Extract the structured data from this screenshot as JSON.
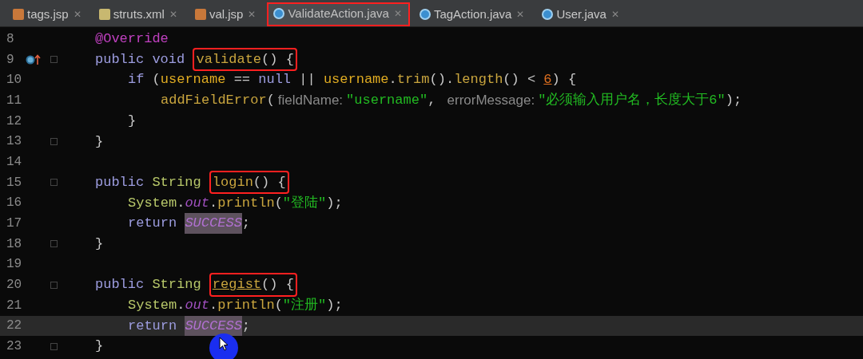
{
  "tabs": [
    {
      "label": "tags.jsp",
      "kind": "jsp",
      "close": "✕",
      "selected": false,
      "boxed": false
    },
    {
      "label": "struts.xml",
      "kind": "xml",
      "close": "✕",
      "selected": false,
      "boxed": false
    },
    {
      "label": "val.jsp",
      "kind": "jsp",
      "close": "✕",
      "selected": false,
      "boxed": false
    },
    {
      "label": "ValidateAction.java",
      "kind": "class",
      "close": "✕",
      "selected": true,
      "boxed": true
    },
    {
      "label": "TagAction.java",
      "kind": "class",
      "close": "✕",
      "selected": false,
      "boxed": false
    },
    {
      "label": "User.java",
      "kind": "class",
      "close": "✕",
      "selected": false,
      "boxed": false
    }
  ],
  "lines": [
    {
      "number": "8",
      "kind": "member",
      "current": false,
      "fold": false,
      "override": false,
      "tokens": [
        {
          "kind": "annotation",
          "text": "@Override"
        }
      ]
    },
    {
      "number": "9",
      "kind": "member",
      "current": false,
      "fold": true,
      "override": true,
      "tokens": [
        {
          "kind": "keyword",
          "text": "public "
        },
        {
          "kind": "keyword",
          "text": "void "
        },
        {
          "kind": "group",
          "boxed": true,
          "tokens": [
            {
              "kind": "method",
              "text": "validate"
            },
            {
              "kind": "plain",
              "text": "() {"
            }
          ]
        }
      ]
    },
    {
      "number": "10",
      "kind": "statement",
      "current": false,
      "fold": false,
      "override": false,
      "tokens": [
        {
          "kind": "keyword",
          "text": "if"
        },
        {
          "kind": "plain",
          "text": " ("
        },
        {
          "kind": "field",
          "text": "username"
        },
        {
          "kind": "plain",
          "text": " == "
        },
        {
          "kind": "keyword",
          "text": "null"
        },
        {
          "kind": "plain",
          "text": " || "
        },
        {
          "kind": "field",
          "text": "username"
        },
        {
          "kind": "plain",
          "text": "."
        },
        {
          "kind": "method",
          "text": "trim"
        },
        {
          "kind": "plain",
          "text": "()."
        },
        {
          "kind": "method",
          "text": "length"
        },
        {
          "kind": "plain",
          "text": "() < "
        },
        {
          "kind": "number",
          "text": "6"
        },
        {
          "kind": "plain",
          "text": ") {"
        }
      ]
    },
    {
      "number": "11",
      "kind": "nested",
      "current": false,
      "fold": false,
      "override": false,
      "tokens": [
        {
          "kind": "method",
          "text": "addFieldError"
        },
        {
          "kind": "plain",
          "text": "("
        },
        {
          "kind": "hint",
          "text": "fieldName:"
        },
        {
          "kind": "string",
          "text": "\"username\""
        },
        {
          "kind": "plain",
          "text": ", "
        },
        {
          "kind": "hint",
          "text": "errorMessage:"
        },
        {
          "kind": "string",
          "text": "\"必须输入用户名，长度大于6\""
        },
        {
          "kind": "plain",
          "text": ");"
        }
      ]
    },
    {
      "number": "12",
      "kind": "statement",
      "current": false,
      "fold": false,
      "override": false,
      "tokens": [
        {
          "kind": "plain",
          "text": "}"
        }
      ]
    },
    {
      "number": "13",
      "kind": "member",
      "current": false,
      "fold": true,
      "override": false,
      "tokens": [
        {
          "kind": "plain",
          "text": "}"
        }
      ]
    },
    {
      "number": "14",
      "kind": "blank",
      "current": false,
      "fold": false,
      "override": false
    },
    {
      "number": "15",
      "kind": "member",
      "current": false,
      "fold": true,
      "override": false,
      "tokens": [
        {
          "kind": "keyword",
          "text": "public "
        },
        {
          "kind": "type",
          "text": "String "
        },
        {
          "kind": "group",
          "boxed": true,
          "tokens": [
            {
              "kind": "method",
              "text": "login"
            },
            {
              "kind": "plain",
              "text": "() {"
            }
          ]
        }
      ]
    },
    {
      "number": "16",
      "kind": "statement",
      "current": false,
      "fold": false,
      "override": false,
      "tokens": [
        {
          "kind": "type",
          "text": "System"
        },
        {
          "kind": "plain",
          "text": "."
        },
        {
          "kind": "static",
          "text": "out"
        },
        {
          "kind": "plain",
          "text": "."
        },
        {
          "kind": "method",
          "text": "println"
        },
        {
          "kind": "plain",
          "text": "("
        },
        {
          "kind": "string",
          "text": "\"登陆\""
        },
        {
          "kind": "plain",
          "text": ");"
        }
      ]
    },
    {
      "number": "17",
      "kind": "statement",
      "current": false,
      "fold": false,
      "override": false,
      "tokens": [
        {
          "kind": "keyword",
          "text": "return "
        },
        {
          "kind": "constant",
          "text": "SUCCESS"
        },
        {
          "kind": "plain",
          "text": ";"
        }
      ]
    },
    {
      "number": "18",
      "kind": "member",
      "current": false,
      "fold": true,
      "override": false,
      "tokens": [
        {
          "kind": "plain",
          "text": "}"
        }
      ]
    },
    {
      "number": "19",
      "kind": "blank",
      "current": false,
      "fold": false,
      "override": false
    },
    {
      "number": "20",
      "kind": "member",
      "current": false,
      "fold": true,
      "override": false,
      "tokens": [
        {
          "kind": "keyword",
          "text": "public "
        },
        {
          "kind": "type",
          "text": "String "
        },
        {
          "kind": "group",
          "boxed": true,
          "tokens": [
            {
              "kind": "method_underlined",
              "text": "regist"
            },
            {
              "kind": "plain",
              "text": "() {"
            }
          ]
        }
      ]
    },
    {
      "number": "21",
      "kind": "statement",
      "current": false,
      "fold": false,
      "override": false,
      "tokens": [
        {
          "kind": "type",
          "text": "System"
        },
        {
          "kind": "plain",
          "text": "."
        },
        {
          "kind": "static",
          "text": "out"
        },
        {
          "kind": "plain",
          "text": "."
        },
        {
          "kind": "method",
          "text": "println"
        },
        {
          "kind": "plain",
          "text": "("
        },
        {
          "kind": "string",
          "text": "\"注册\""
        },
        {
          "kind": "plain",
          "text": ");"
        }
      ]
    },
    {
      "number": "22",
      "kind": "statement",
      "current": true,
      "fold": false,
      "override": false,
      "tokens": [
        {
          "kind": "keyword",
          "text": "return "
        },
        {
          "kind": "constant",
          "text": "SUCCESS"
        },
        {
          "kind": "plain",
          "text": ";"
        }
      ]
    },
    {
      "number": "23",
      "kind": "member",
      "current": false,
      "fold": true,
      "override": false,
      "tokens": [
        {
          "kind": "plain",
          "text": "}"
        }
      ]
    }
  ]
}
